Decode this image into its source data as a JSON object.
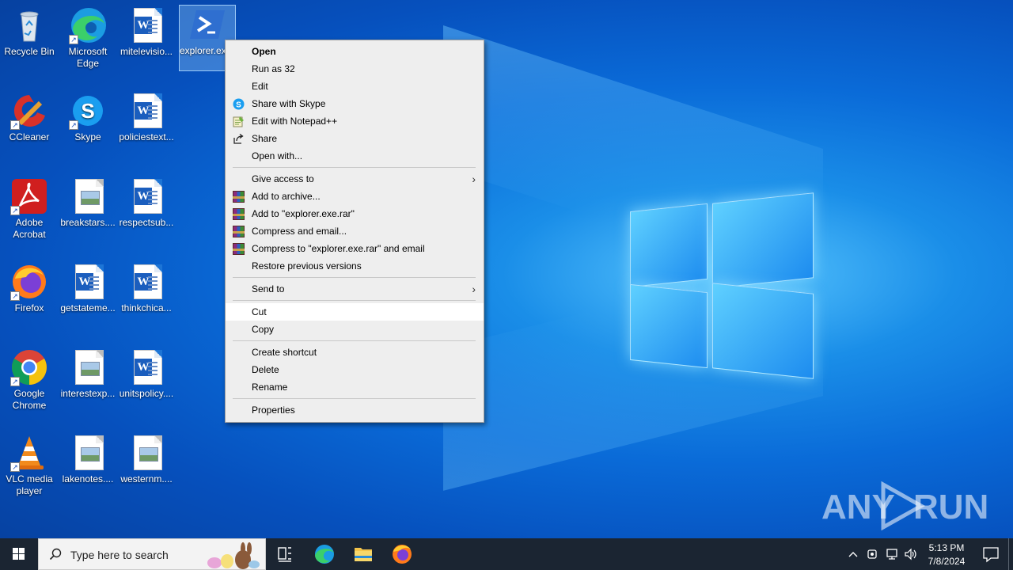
{
  "desktop": {
    "icons": [
      {
        "label": "Recycle Bin",
        "icon": "recycle-bin-icon"
      },
      {
        "label": "Microsoft Edge",
        "icon": "edge-icon"
      },
      {
        "label": "mitelevisio...",
        "icon": "word-doc-icon"
      },
      {
        "label": "explorer.exe.ps1",
        "icon": "powershell-icon"
      },
      {
        "label": "CCleaner",
        "icon": "ccleaner-icon"
      },
      {
        "label": "Skype",
        "icon": "skype-icon"
      },
      {
        "label": "policiestext...",
        "icon": "word-doc-icon"
      },
      {
        "label": "Adobe Acrobat",
        "icon": "acrobat-icon"
      },
      {
        "label": "breakstars....",
        "icon": "image-file-icon"
      },
      {
        "label": "respectsub...",
        "icon": "word-doc-icon"
      },
      {
        "label": "Firefox",
        "icon": "firefox-icon"
      },
      {
        "label": "getstateme...",
        "icon": "word-doc-icon"
      },
      {
        "label": "thinkchica...",
        "icon": "word-doc-icon"
      },
      {
        "label": "Google Chrome",
        "icon": "chrome-icon"
      },
      {
        "label": "interestexp...",
        "icon": "image-file-icon"
      },
      {
        "label": "unitspolicy....",
        "icon": "word-doc-icon"
      },
      {
        "label": "VLC media player",
        "icon": "vlc-icon"
      },
      {
        "label": "lakenotes....",
        "icon": "image-file-icon"
      },
      {
        "label": "westernm....",
        "icon": "image-file-icon"
      }
    ]
  },
  "context_menu": {
    "items": {
      "open": "Open",
      "run_as_32": "Run as 32",
      "edit": "Edit",
      "share_skype": "Share with Skype",
      "edit_notepadpp": "Edit with Notepad++",
      "share": "Share",
      "open_with": "Open with...",
      "give_access": "Give access to",
      "add_archive": "Add to archive...",
      "add_to_rar": "Add to \"explorer.exe.rar\"",
      "compress_email": "Compress and email...",
      "compress_rar_email": "Compress to \"explorer.exe.rar\" and email",
      "restore_versions": "Restore previous versions",
      "send_to": "Send to",
      "cut": "Cut",
      "copy": "Copy",
      "create_shortcut": "Create shortcut",
      "delete": "Delete",
      "rename": "Rename",
      "properties": "Properties"
    },
    "submenu_arrow": ">"
  },
  "taskbar": {
    "search_placeholder": "Type here to search",
    "time": "5:13 PM",
    "date": "7/8/2024",
    "tray_chevron": "^"
  },
  "watermark": {
    "text_left": "ANY",
    "text_right": "RUN"
  }
}
